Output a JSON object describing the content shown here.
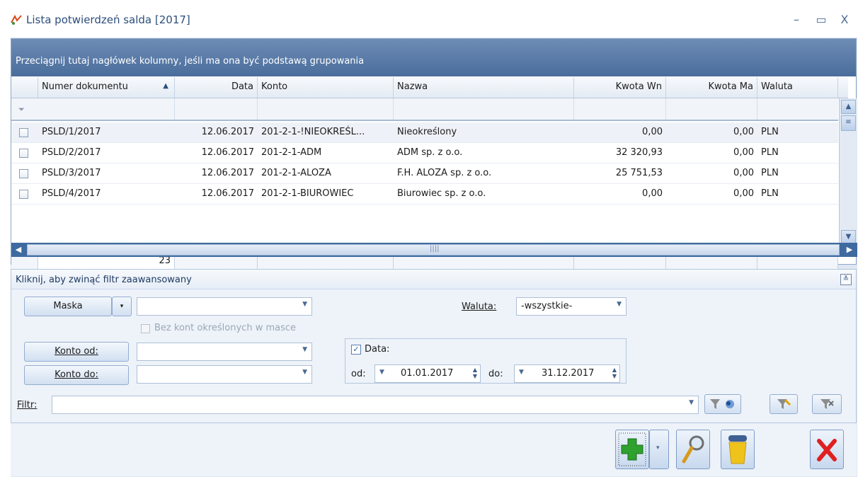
{
  "window": {
    "title": "Lista potwierdzeń salda [2017]",
    "minimize": "–",
    "maximize": "▭",
    "close": "X"
  },
  "grid": {
    "group_hint": "Przeciągnij tutaj nagłówek kolumny, jeśli ma ona być podstawą grupowania",
    "columns": {
      "numer": "Numer dokumentu",
      "data": "Data",
      "konto": "Konto",
      "nazwa": "Nazwa",
      "wn": "Kwota Wn",
      "ma": "Kwota Ma",
      "waluta": "Waluta"
    },
    "sort_indicator": "▲",
    "rows": [
      {
        "numer": "PSLD/1/2017",
        "data": "12.06.2017",
        "konto": "201-2-1-!NIEOKREŚL...",
        "nazwa": "Nieokreślony",
        "wn": "0,00",
        "ma": "0,00",
        "waluta": "PLN"
      },
      {
        "numer": "PSLD/2/2017",
        "data": "12.06.2017",
        "konto": "201-2-1-ADM",
        "nazwa": "ADM sp. z o.o.",
        "wn": "32 320,93",
        "ma": "0,00",
        "waluta": "PLN"
      },
      {
        "numer": "PSLD/3/2017",
        "data": "12.06.2017",
        "konto": "201-2-1-ALOZA",
        "nazwa": "F.H. ALOZA sp. z o.o.",
        "wn": "25 751,53",
        "ma": "0,00",
        "waluta": "PLN"
      },
      {
        "numer": "PSLD/4/2017",
        "data": "12.06.2017",
        "konto": "201-2-1-BIUROWIEC",
        "nazwa": "Biurowiec sp. z o.o.",
        "wn": "0,00",
        "ma": "0,00",
        "waluta": "PLN"
      }
    ],
    "count": "23"
  },
  "filter": {
    "toggle_text": "Kliknij, aby zwinąć filtr zaawansowany",
    "maska_label": "Maska",
    "bez_kont": "Bez kont określonych w masce",
    "konto_od": "Konto od:",
    "konto_do": "Konto do:",
    "waluta_label": "Waluta:",
    "waluta_value": "-wszystkie-",
    "data_label": "Data:",
    "od_label": "od:",
    "od_value": "01.01.2017",
    "do_label": "do:",
    "do_value": "31.12.2017",
    "filtr_label": "Filtr:"
  },
  "icons": {
    "app": "app-icon",
    "funnel": "funnel-icon",
    "add": "plus-icon",
    "search": "magnifier-icon",
    "trash": "trash-icon",
    "close": "close-icon"
  },
  "colors": {
    "accent": "#4a6d9b",
    "close_red": "#e02020",
    "plus_green": "#2ea12e"
  }
}
